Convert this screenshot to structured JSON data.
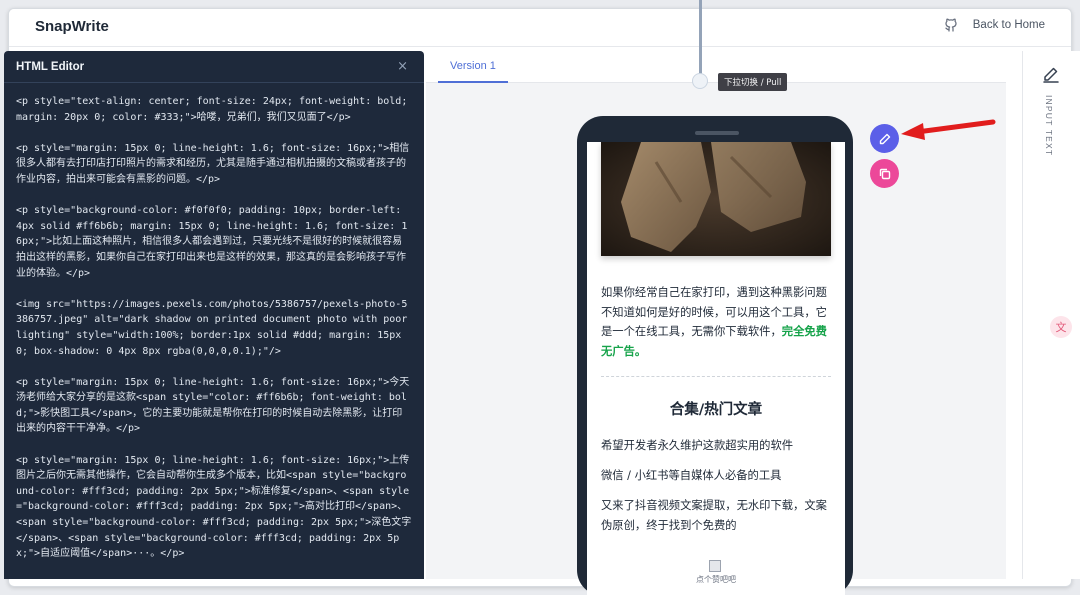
{
  "header": {
    "brand": "SnapWrite",
    "back_label": "Back to Home"
  },
  "editor": {
    "title": "HTML Editor",
    "close_glyph": "×",
    "code_lines": [
      "<p style=\"text-align: center; font-size: 24px; font-weight: bold; margin: 20px 0; color: #333;\">哈喽，兄弟们，我们又见面了</p>",
      "<p style=\"margin: 15px 0; line-height: 1.6; font-size: 16px;\">相信很多人都有去打印店打印照片的需求和经历，尤其是随手通过相机拍摄的文稿或者孩子的作业内容，拍出来可能会有黑影的问题。</p>",
      "<p style=\"background-color: #f0f0f0; padding: 10px; border-left: 4px solid #ff6b6b; margin: 15px 0; line-height: 1.6; font-size: 16px;\">比如上面这种照片，相信很多人都会遇到过，只要光线不是很好的时候就很容易拍出这样的黑影，如果你自己在家打印出来也是这样的效果，那这真的是会影响孩子写作业的体验。</p>",
      "<img src=\"https://images.pexels.com/photos/5386757/pexels-photo-5386757.jpeg\" alt=\"dark shadow on printed document photo with poor lighting\" style=\"width:100%; border:1px solid #ddd; margin: 15px 0; box-shadow: 0 4px 8px rgba(0,0,0,0.1);\"/>",
      "<p style=\"margin: 15px 0; line-height: 1.6; font-size: 16px;\">今天汤老师给大家分享的是这款<span style=\"color: #ff6b6b; font-weight: bold;\">影快图工具</span>，它的主要功能就是帮你在打印的时候自动去除黑影，让打印出来的内容干干净净。</p>",
      "<p style=\"margin: 15px 0; line-height: 1.6; font-size: 16px;\">上传图片之后你无需其他操作，它会自动帮你生成多个版本，比如<span style=\"background-color: #fff3cd; padding: 2px 5px;\">标准修复</span>、<span style=\"background-color: #fff3cd; padding: 2px 5px;\">高对比打印</span>、<span style=\"background-color: #fff3cd; padding: 2px 5px;\">深色文字</span>、<span style=\"background-color: #fff3cd; padding: 2px 5px;\">自适应阈值</span>···。</p>"
    ]
  },
  "tabs": [
    {
      "label": "Version 1"
    }
  ],
  "pull_tip": "下拉切换 / Pull",
  "preview": {
    "intro_text": "如果你经常自己在家打印，遇到这种黑影问题不知道如何是好的时候，可以用这个工具，它是一个在线工具，无需你下载软件，",
    "intro_highlight": "完全免费无广告。",
    "section_title": "合集/热门文章",
    "articles": [
      "希望开发者永久维护这款超实用的软件",
      "微信 / 小红书等自媒体人必备的工具",
      "又来了抖音视频文案提取，无水印下载，文案伪原创，终于找到个免费的"
    ],
    "image_caption": "点个赞吧吧"
  },
  "sidebar": {
    "label": "INPUT TEXT"
  },
  "icons": {
    "back": "github-icon",
    "edit": "pencil-icon",
    "copy": "copy-icon",
    "side_edit": "pencil-icon",
    "badge": "translate-icon"
  },
  "colors": {
    "accent": "#4f6fd6",
    "edit_fab": "#5b5fe8",
    "copy_fab": "#ec4899",
    "editor_bg": "#1e293b",
    "highlight_green": "#16a34a",
    "annotation_arrow": "#e11d1d"
  }
}
